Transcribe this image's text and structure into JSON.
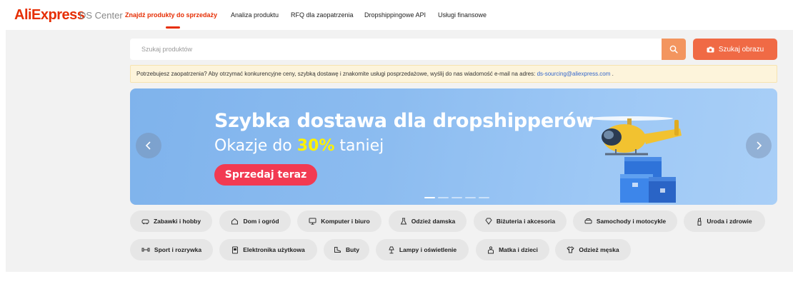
{
  "header": {
    "logo": "AliExpress",
    "logo_sub": "DS Center",
    "nav": [
      {
        "label": "Znajdź produkty do sprzedaży",
        "active": true
      },
      {
        "label": "Analiza produktu",
        "active": false
      },
      {
        "label": "RFQ dla zaopatrzenia",
        "active": false
      },
      {
        "label": "Dropshippingowe API",
        "active": false
      },
      {
        "label": "Usługi finansowe",
        "active": false
      }
    ]
  },
  "search": {
    "placeholder": "Szukaj produktów",
    "search_icon": "search-icon",
    "image_search_label": "Szukaj obrazu",
    "image_search_icon": "camera-icon"
  },
  "notice": {
    "text": "Potrzebujesz zaopatrzenia? Aby otrzymać konkurencyjne ceny, szybką dostawę i znakomite usługi posprzedażowe, wyślij do nas wiadomość e-mail na adres: ",
    "email": "ds-sourcing@aliexpress.com",
    "trail": " ."
  },
  "banner": {
    "title": "Szybka dostawa dla dropshipperów",
    "subtitle_pre": "Okazje do ",
    "subtitle_highlight": "30%",
    "subtitle_post": " taniej",
    "cta": "Sprzedaj teraz",
    "slide_count": 5,
    "active_slide": 1
  },
  "categories": {
    "row1": [
      {
        "label": "Zabawki i hobby",
        "icon": "toy-car-icon"
      },
      {
        "label": "Dom i ogród",
        "icon": "home-icon"
      },
      {
        "label": "Komputer i biuro",
        "icon": "monitor-icon"
      },
      {
        "label": "Odzież damska",
        "icon": "dress-icon"
      },
      {
        "label": "Biżuteria i akcesoria",
        "icon": "gem-icon"
      },
      {
        "label": "Samochody i motocykle",
        "icon": "car-icon"
      },
      {
        "label": "Uroda i zdrowie",
        "icon": "lipstick-icon"
      }
    ],
    "row2": [
      {
        "label": "Sport i rozrywka",
        "icon": "dumbbell-icon"
      },
      {
        "label": "Elektronika użytkowa",
        "icon": "device-icon"
      },
      {
        "label": "Buty",
        "icon": "shoe-icon"
      },
      {
        "label": "Lampy i oświetlenie",
        "icon": "lamp-icon"
      },
      {
        "label": "Matka i dzieci",
        "icon": "baby-icon"
      },
      {
        "label": "Odzież męska",
        "icon": "shirt-icon"
      }
    ]
  },
  "colors": {
    "brand": "#e62e04",
    "search_button": "#f3955f",
    "image_search_button": "#f06a45",
    "cta": "#f23a52",
    "highlight": "#fff200",
    "link": "#3366cc"
  }
}
